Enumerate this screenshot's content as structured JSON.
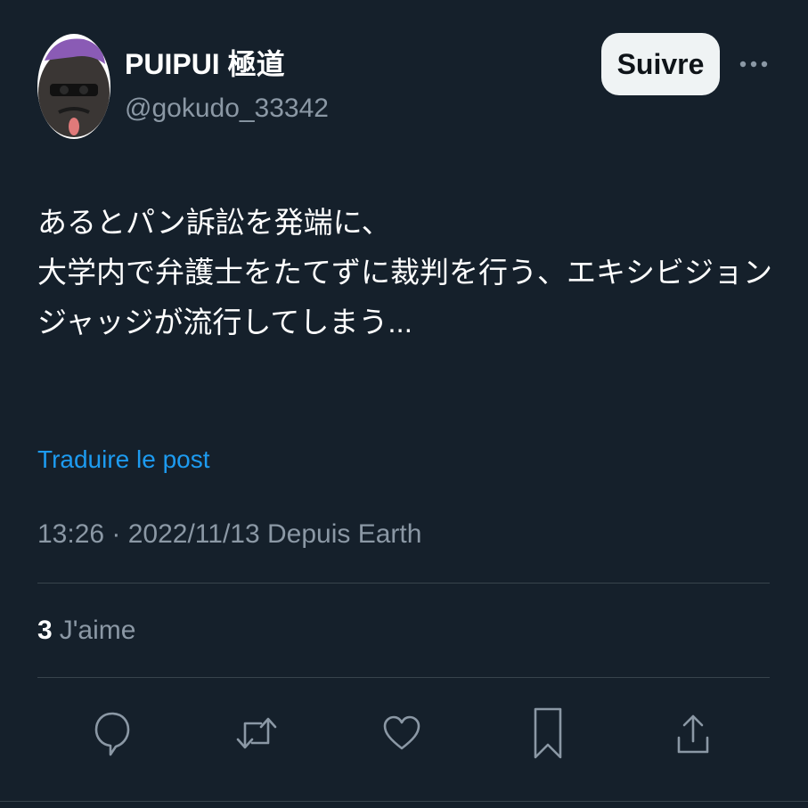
{
  "author": {
    "display_name": "PUIPUI 極道",
    "handle": "@gokudo_33342",
    "avatar_icon": "avatar-icon"
  },
  "header": {
    "follow_label": "Suivre",
    "more_icon": "more-icon"
  },
  "tweet": {
    "lines": [
      "あるとパン訴訟を発端に、",
      "大学内で弁護士をたてずに裁判を行う、エキシビジョン",
      "ジャッジが流行してしまう..."
    ],
    "translate_label": "Traduire le post",
    "meta": "13:26 · 2022/11/13 Depuis Earth"
  },
  "stats": {
    "likes_count": "3",
    "likes_label": "J'aime"
  },
  "actions": [
    {
      "name": "reply-icon"
    },
    {
      "name": "retweet-icon"
    },
    {
      "name": "like-icon"
    },
    {
      "name": "bookmark-icon"
    },
    {
      "name": "share-icon"
    }
  ],
  "colors": {
    "background": "#15202b",
    "accent": "#1d9bf0",
    "muted": "#8b98a5",
    "follow_bg": "#eff3f4"
  }
}
